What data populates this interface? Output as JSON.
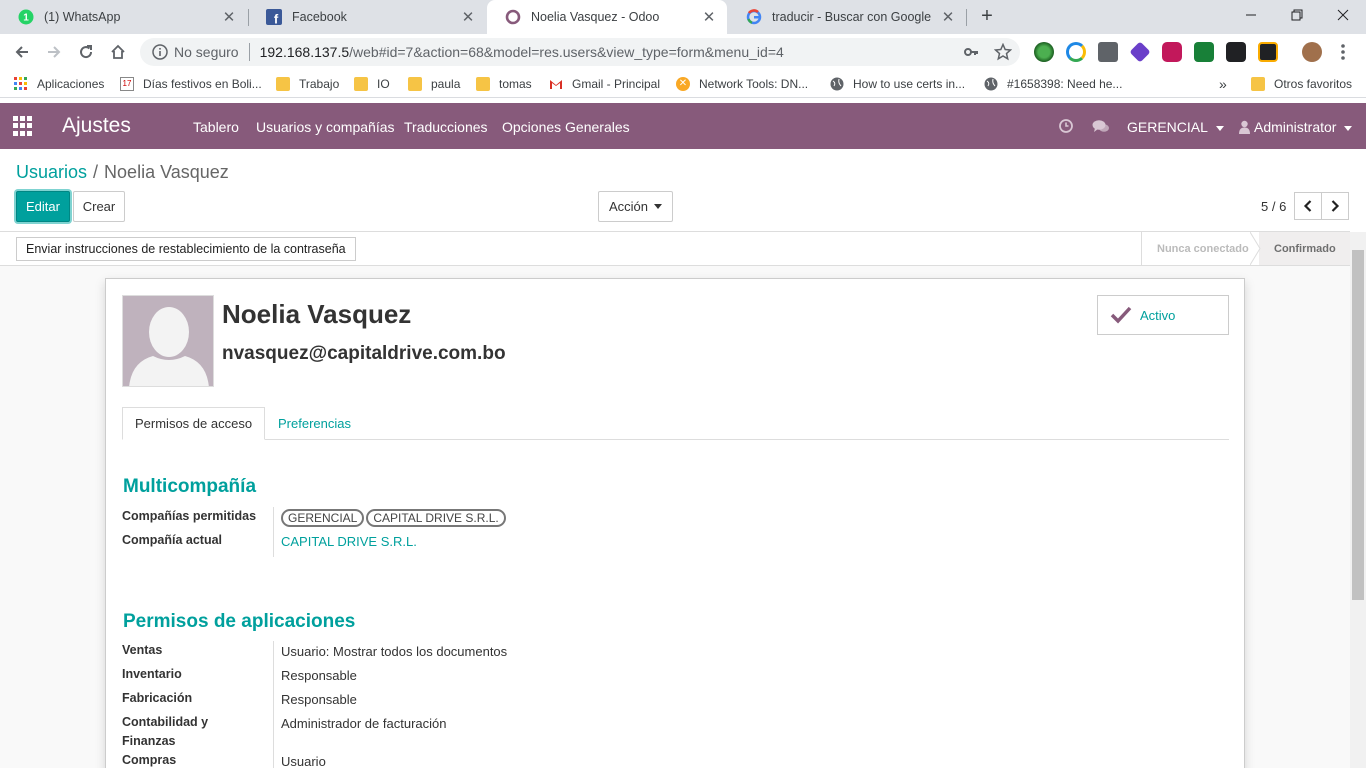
{
  "browser": {
    "tabs": [
      {
        "title": "(1) WhatsApp",
        "icon": "whatsapp-icon"
      },
      {
        "title": "Facebook",
        "icon": "facebook-icon"
      },
      {
        "title": "Noelia Vasquez - Odoo",
        "icon": "odoo-icon"
      },
      {
        "title": "traducir - Buscar con Google",
        "icon": "google-icon"
      }
    ],
    "omnibox": {
      "security": "No seguro",
      "host": "192.168.137.5",
      "path": "/web#id=7&action=68&model=res.users&view_type=form&menu_id=4"
    },
    "bookmarks": [
      {
        "label": "Aplicaciones"
      },
      {
        "label": "Días festivos en Boli..."
      },
      {
        "label": "Trabajo"
      },
      {
        "label": "IO"
      },
      {
        "label": "paula"
      },
      {
        "label": "tomas"
      },
      {
        "label": "Gmail - Principal"
      },
      {
        "label": "Network Tools: DN..."
      },
      {
        "label": "How to use certs in..."
      },
      {
        "label": "#1658398: Need he..."
      },
      {
        "label": "Otros favoritos"
      }
    ],
    "overflow": "»"
  },
  "odoo_nav": {
    "brand": "Ajustes",
    "menus": [
      "Tablero",
      "Usuarios y compañías",
      "Traducciones",
      "Opciones Generales"
    ],
    "company": "GERENCIAL",
    "user": "Administrator",
    "brand_color": "#875a7b"
  },
  "control_panel": {
    "breadcrumb_parent": "Usuarios",
    "breadcrumb_sep": "/",
    "breadcrumb_current": "Noelia Vasquez",
    "edit_label": "Editar",
    "create_label": "Crear",
    "action_label": "Acción",
    "pager": "5 / 6"
  },
  "statusbar": {
    "reset_password_label": "Enviar instrucciones de restablecimiento de la contraseña",
    "stages": [
      "Nunca conectado",
      "Confirmado"
    ],
    "active_stage": "Confirmado"
  },
  "form": {
    "name": "Noelia Vasquez",
    "email": "nvasquez@capitaldrive.com.bo",
    "active_label": "Activo",
    "tabs": [
      "Permisos de acceso",
      "Preferencias"
    ],
    "multicompany": {
      "title": "Multicompañía",
      "allowed_label": "Compañías permitidas",
      "allowed": [
        "GERENCIAL",
        "CAPITAL DRIVE S.R.L."
      ],
      "current_label": "Compañía actual",
      "current": "CAPITAL DRIVE S.R.L."
    },
    "app_permissions": {
      "title": "Permisos de aplicaciones",
      "rows": [
        {
          "label": "Ventas",
          "value": "Usuario: Mostrar todos los documentos"
        },
        {
          "label": "Inventario",
          "value": "Responsable"
        },
        {
          "label": "Fabricación",
          "value": "Responsable"
        },
        {
          "label": "Contabilidad y Finanzas",
          "value": "Administrador de facturación"
        },
        {
          "label": "Compras",
          "value": "Usuario"
        }
      ]
    }
  },
  "colors": {
    "accent": "#00a09d",
    "odoo_purple": "#875a7b"
  }
}
